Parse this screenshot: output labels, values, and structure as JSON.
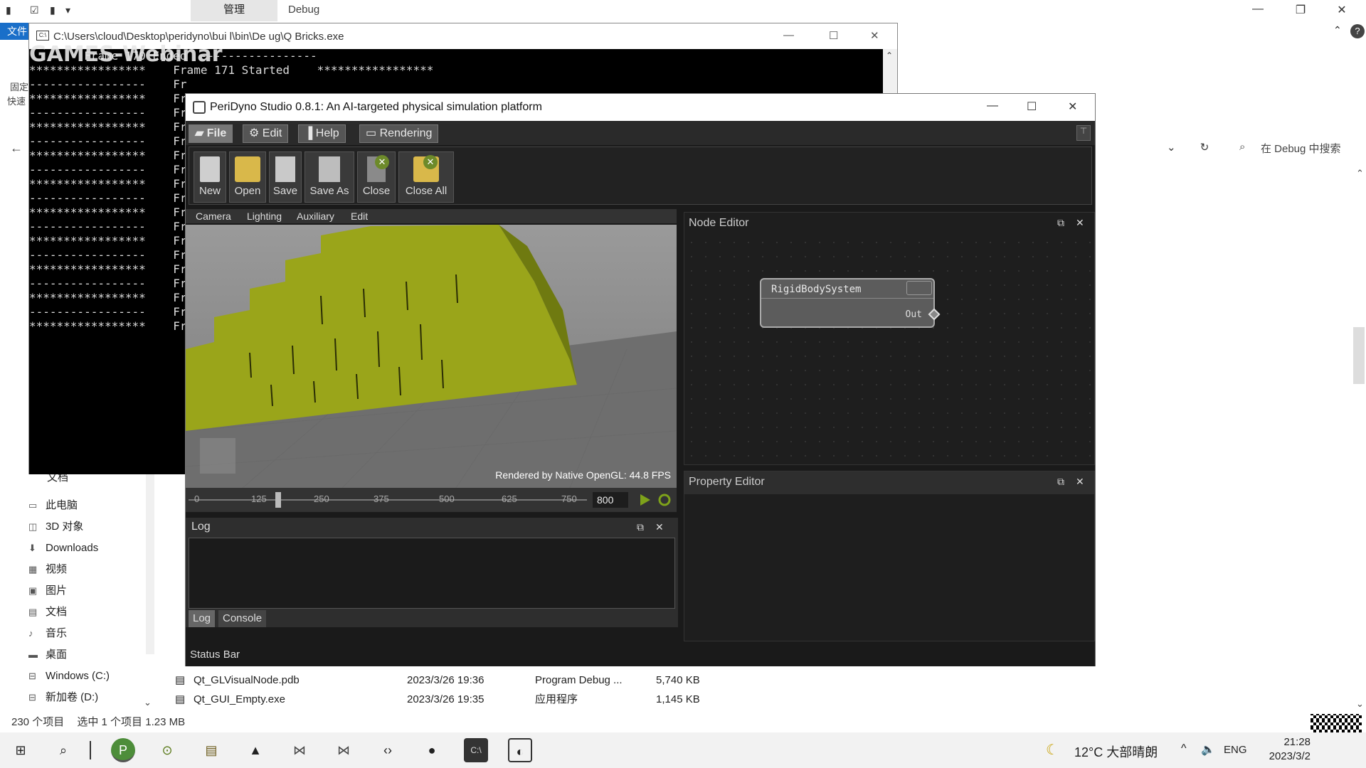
{
  "explorer": {
    "ribbon_file": "文件",
    "context_tab": "管理",
    "location_tab": "Debug",
    "search_placeholder": "在 Debug 中搜索",
    "side_left_labels": [
      "固定",
      "快速"
    ],
    "sidebar": [
      {
        "label": "文档",
        "icon": "document-icon"
      },
      {
        "label": "此电脑",
        "icon": "computer-icon"
      },
      {
        "label": "3D 对象",
        "icon": "cube-icon"
      },
      {
        "label": "Downloads",
        "icon": "download-icon"
      },
      {
        "label": "视频",
        "icon": "video-icon"
      },
      {
        "label": "图片",
        "icon": "picture-icon"
      },
      {
        "label": "文档",
        "icon": "document-icon"
      },
      {
        "label": "音乐",
        "icon": "music-icon"
      },
      {
        "label": "桌面",
        "icon": "desktop-icon"
      },
      {
        "label": "Windows (C:)",
        "icon": "drive-icon"
      },
      {
        "label": "新加卷 (D:)",
        "icon": "drive-icon"
      }
    ],
    "files": [
      {
        "name": "Qt_GLVisualNode.pdb",
        "date": "2023/3/26 19:36",
        "type": "Program Debug ...",
        "size": "5,740 KB"
      },
      {
        "name": "Qt_GUI_Empty.exe",
        "date": "2023/3/26 19:35",
        "type": "应用程序",
        "size": "1,145 KB"
      }
    ],
    "status_items": "230 个项目",
    "status_selected": "选中 1 个项目  1.23 MB"
  },
  "console": {
    "title": "C:\\Users\\cloud\\Desktop\\peridyno\\bui  l\\bin\\De  ug\\Q  Bricks.exe",
    "watermark": "GAMES-Webinar",
    "first_line": "        Frame 170 Ended  -----------------",
    "frame_started": "Frame 171 Started",
    "stars": "*****************",
    "dashes": "-----------------",
    "fr": "Fr"
  },
  "peridyno": {
    "title": "PeriDyno Studio 0.8.1:  An AI-targeted physical simulation platform",
    "menu": [
      "File",
      "Edit",
      "Help",
      "Rendering"
    ],
    "toolbar": [
      "New",
      "Open",
      "Save",
      "Save As",
      "Close",
      "Close All"
    ],
    "viewport_menu": [
      "Camera",
      "Lighting",
      "Auxiliary",
      "Edit"
    ],
    "fps_text": "Rendered by Native OpenGL: 44.8 FPS",
    "timeline_ticks": [
      "0",
      "125",
      "250",
      "375",
      "500",
      "625",
      "750"
    ],
    "frame_max": "800",
    "log_title": "Log",
    "log_tabs": [
      "Log",
      "Console"
    ],
    "node_editor_title": "Node Editor",
    "node_name": "RigidBodySystem",
    "node_port": "Out",
    "property_editor_title": "Property Editor",
    "status_bar": "Status Bar"
  },
  "taskbar": {
    "weather": "12°C  大部晴朗",
    "lang": "ENG",
    "time": "21:28",
    "date": "2023/3/2"
  },
  "colors": {
    "brick": "#9aa51a",
    "floor": "#7d7d7d",
    "accent": "#1a6fc9"
  }
}
